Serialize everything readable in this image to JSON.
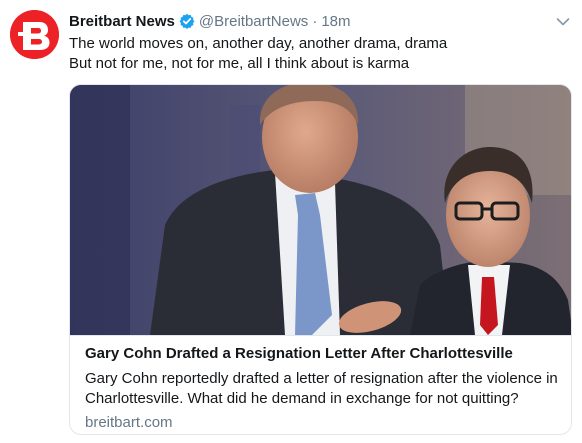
{
  "tweet": {
    "display_name": "Breitbart News",
    "handle": "@BreitbartNews",
    "separator": "·",
    "time": "18m",
    "text_lines": [
      "The world moves on, another day, another drama, drama",
      "But not for me, not for me, all I think about is karma"
    ],
    "verified": true
  },
  "card": {
    "title": "Gary Cohn Drafted a Resignation Letter After Charlottesville",
    "description_lines": [
      "Gary Cohn reportedly drafted a letter of resignation after the violence in",
      "Charlottesville. What did he demand in exchange for not quitting?"
    ],
    "domain": "breitbart.com"
  },
  "colors": {
    "brand": "#ec2227",
    "verified": "#1da1f2",
    "secondary_text": "#657786",
    "border": "#e1e8ed"
  },
  "icons": {
    "avatar": "breitbart-b-logo",
    "verified": "verified-badge-icon",
    "caret": "chevron-down-icon"
  }
}
